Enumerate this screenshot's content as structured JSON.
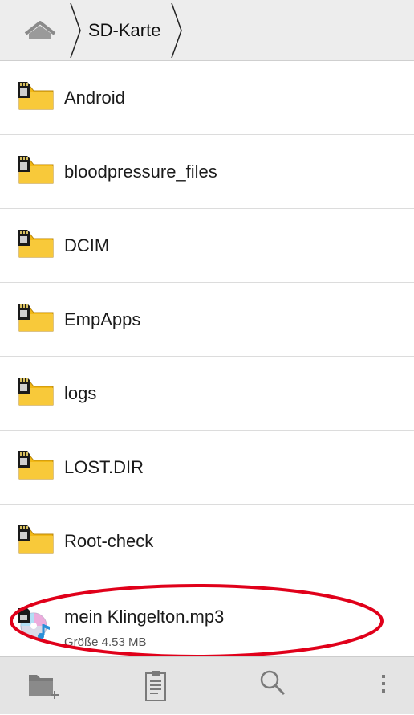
{
  "breadcrumb": {
    "home_icon": "home-icon",
    "current": "SD-Karte"
  },
  "folders": [
    {
      "name": "Android"
    },
    {
      "name": "bloodpressure_files"
    },
    {
      "name": "DCIM"
    },
    {
      "name": "EmpApps"
    },
    {
      "name": "logs"
    },
    {
      "name": "LOST.DIR"
    },
    {
      "name": "Root-check"
    }
  ],
  "file": {
    "name": "mein Klingelton.mp3",
    "size": "Größe 4.53 MB"
  },
  "toolbar": {
    "buttons": [
      "new-folder-icon",
      "clipboard-icon",
      "search-icon",
      "overflow-menu-icon"
    ]
  },
  "colors": {
    "folder": "#f2b814",
    "annotation": "#e0001a",
    "toolbar_icon": "#7a7a7a"
  }
}
